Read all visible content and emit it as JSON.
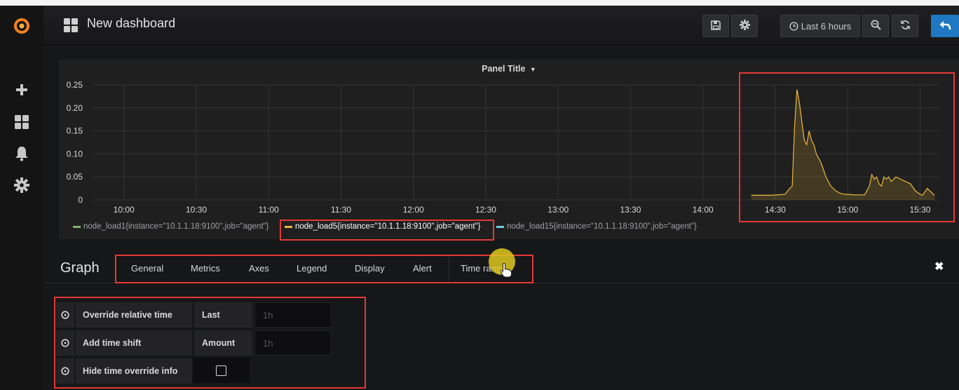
{
  "navbar": {
    "title": "New dashboard",
    "time_range_label": "Last 6 hours",
    "icons": [
      "dashboard-grid-icon",
      "save-icon",
      "settings-gear-icon",
      "clock-icon",
      "zoom-out-icon",
      "refresh-icon",
      "back-arrow-icon"
    ]
  },
  "sidebar": {
    "icons": [
      "grafana-logo-icon",
      "plus-icon",
      "dashboards-icon",
      "alert-bell-icon",
      "gear-icon"
    ]
  },
  "panel": {
    "title": "Panel Title",
    "legend": [
      {
        "label": "node_load1{instance=\"10.1.1.18:9100\",job=\"agent\"}",
        "color": "#7eb26d"
      },
      {
        "label": "node_load5{instance=\"10.1.1.18:9100\",job=\"agent\"}",
        "color": "#eab839"
      },
      {
        "label": "node_load15{instance=\"10.1.1.18:9100\",job=\"agent\"}",
        "color": "#6ed0e0"
      }
    ]
  },
  "chart_data": {
    "type": "area",
    "y_ticks": [
      "0.25",
      "0.20",
      "0.15",
      "0.10",
      "0.05",
      "0"
    ],
    "x_ticks": [
      "10:00",
      "10:30",
      "11:00",
      "11:30",
      "12:00",
      "12:30",
      "13:00",
      "13:30",
      "14:00",
      "14:30",
      "15:00",
      "15:30"
    ],
    "ylim": [
      0,
      0.25
    ],
    "xlim": [
      "09:47",
      "15:38"
    ],
    "grid": true,
    "series": [
      {
        "name": "node_load5{instance=\"10.1.1.18:9100\",job=\"agent\"}",
        "color": "#eab839",
        "x": [
          "14:20",
          "14:28",
          "14:34",
          "14:36",
          "14:37",
          "14:38",
          "14:39",
          "14:40",
          "14:41",
          "14:42",
          "14:43",
          "14:44",
          "14:45",
          "14:46",
          "14:47",
          "14:49",
          "14:51",
          "14:53",
          "14:55",
          "14:57",
          "14:59",
          "15:00",
          "15:03",
          "15:07",
          "15:09",
          "15:10",
          "15:11",
          "15:12",
          "15:13",
          "15:14",
          "15:15",
          "15:16",
          "15:17",
          "15:18",
          "15:20",
          "15:22",
          "15:24",
          "15:26",
          "15:28",
          "15:30",
          "15:31",
          "15:33",
          "15:34",
          "15:36"
        ],
        "values": [
          0.01,
          0.01,
          0.012,
          0.025,
          0.03,
          0.16,
          0.24,
          0.21,
          0.17,
          0.13,
          0.12,
          0.15,
          0.13,
          0.12,
          0.1,
          0.08,
          0.05,
          0.03,
          0.02,
          0.014,
          0.012,
          0.012,
          0.011,
          0.011,
          0.03,
          0.055,
          0.045,
          0.05,
          0.035,
          0.03,
          0.05,
          0.045,
          0.05,
          0.04,
          0.05,
          0.045,
          0.04,
          0.035,
          0.02,
          0.012,
          0.01,
          0.025,
          0.02,
          0.01
        ]
      }
    ]
  },
  "editor": {
    "title": "Graph",
    "tabs": [
      "General",
      "Metrics",
      "Axes",
      "Legend",
      "Display",
      "Alert",
      "Time range"
    ]
  },
  "time_range_form": {
    "override_relative_label": "Override relative time",
    "last_label": "Last",
    "last_placeholder": "1h",
    "time_shift_label": "Add time shift",
    "amount_label": "Amount",
    "amount_placeholder": "1h",
    "hide_info_label": "Hide time override info",
    "hide_info_checked": false
  },
  "colors": {
    "accent": "#1f78c1",
    "highlight": "#e53935",
    "series": "#eab839"
  }
}
